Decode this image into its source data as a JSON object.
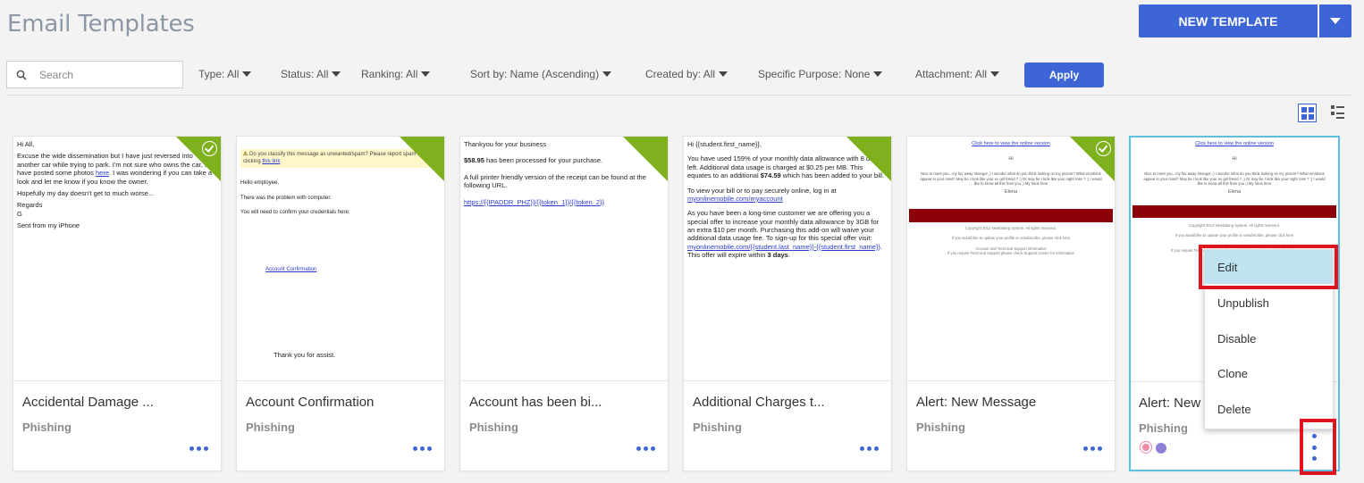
{
  "header": {
    "title": "Email Templates",
    "new_template_label": "NEW TEMPLATE"
  },
  "search": {
    "placeholder": "Search"
  },
  "filters": [
    {
      "label": "Type: All"
    },
    {
      "label": "Status: All"
    },
    {
      "label": "Ranking: All"
    },
    {
      "label": "Sort by: Name (Ascending)"
    },
    {
      "label": "Created by: All"
    },
    {
      "label": "Specific Purpose: None"
    },
    {
      "label": "Attachment: All"
    }
  ],
  "apply_label": "Apply",
  "colors": {
    "accent": "#3d65d6",
    "published_corner": "#7fb01d",
    "selected_border": "#5ec0df",
    "highlight_red": "#e0141f",
    "menu_highlight": "#bfe3f0"
  },
  "cards": [
    {
      "title": "Accidental Damage ...",
      "type": "Phishing",
      "published": true,
      "preview": {
        "line1": "Hi All,",
        "line2a": "Excuse the wide dissemination but I have just reversed into another car while trying to park. I'm not sure who owns the car, I have posted some photos ",
        "line2link": "here",
        "line2b": ". I was wondering if you can take a look and let me know if you know the owner.",
        "line3": "Hopefully my day doesn't get to much worse...",
        "line4": "Regards",
        "line5": "G",
        "line6": "Sent from my iPhone"
      }
    },
    {
      "title": "Account Confirmation",
      "type": "Phishing",
      "published": true,
      "preview": {
        "banner": "Do you classify this message as unwanted/spam? Please report spam by clicking ",
        "banner_link": "this link",
        "line1": "Hello employee,",
        "line2": "There was the problem with computer.",
        "line3": "You will need to confirm your credentials here:",
        "link": "Account Confirmation",
        "footer": "Thank you for assist."
      }
    },
    {
      "title": "Account has been bi...",
      "type": "Phishing",
      "published": true,
      "preview": {
        "line1": "Thankyou for your business",
        "amount": "$58.95",
        "line2": " has been processed for your purchase.",
        "line3": "A full printer friendly version of the receipt can be found at the following URL.",
        "link": "https://{{IPADDR_PHZ}}/{{token_1}}/{{token_2}}"
      }
    },
    {
      "title": "Additional Charges t...",
      "type": "Phishing",
      "published": true,
      "preview": {
        "line1": "Hi {{student.first_name}},",
        "line2a": "You have used 159% of your monthly data allowance with 8 days left. Additional data usage is charged at $0.25 per MB. This equates to an additional ",
        "line2amount": "$74.59",
        "line2b": " which has been added to your bill.",
        "line3": "To view your bill or to pay securely online, log in at ",
        "line3link": "myonlinemobile.com/myaccount",
        "line4a": "As you have been a long-time customer we are offering you a special offer to increase your monthly data allowance by 3GB for an extra $10 per month. Purchasing this add-on will waive your additional data usage fee. To sign-up for this special offer visit: ",
        "line4link": "myonlinemobile.com/{{student.last_name}}-{{student.first_name}}",
        "line4b": ". This offer will expire within ",
        "line4bold": "3 days",
        "line4end": "."
      }
    },
    {
      "title": "Alert: New Message",
      "type": "Phishing",
      "published": true,
      "preview": {
        "top": "Click here to view the online version",
        "hi": "Hi",
        "body": "Nice to meet you...my fav away stranger ;) I wonder what do you think looking on my picture? What emotions appear in your mind? May be I look like your ex girl friend ? :) Or may be I look like your night rose ? ;) I would like to know all this from you ;) My fotos here",
        "sign": "Elena",
        "copyright": "Copyright 2012 NewDating System. All rights reserved.",
        "unsub": "If you would like to update your profile or unsubscribe, please click here",
        "f1": "Account and Technical Support information",
        "f2": "If you require Technical Support please check Support Center for information"
      }
    },
    {
      "title": "Alert: New Message",
      "type": "Phishing",
      "published": false,
      "selected": true,
      "preview": {
        "top": "Click here to view the online version",
        "hi": "Hi",
        "body": "Nice to meet you...my fav away stranger ;) I wonder what do you think looking on my picture? What emotions appear in your mind? May be I look like your ex girl friend ? :) Or may be I look like your night rose ? ;) I would like to know all this from you ;) My fotos here",
        "sign": "Elena",
        "copyright": "Copyright 2012 NewDating System. All rights reserved.",
        "unsub": "If you would like to update your profile or unsubscribe, please click here",
        "f1": "Account and Technical Support information",
        "f2": "If you require Technical Support please check Support Center for information"
      }
    }
  ],
  "context_menu": {
    "items": [
      "Edit",
      "Unpublish",
      "Disable",
      "Clone",
      "Delete"
    ]
  }
}
